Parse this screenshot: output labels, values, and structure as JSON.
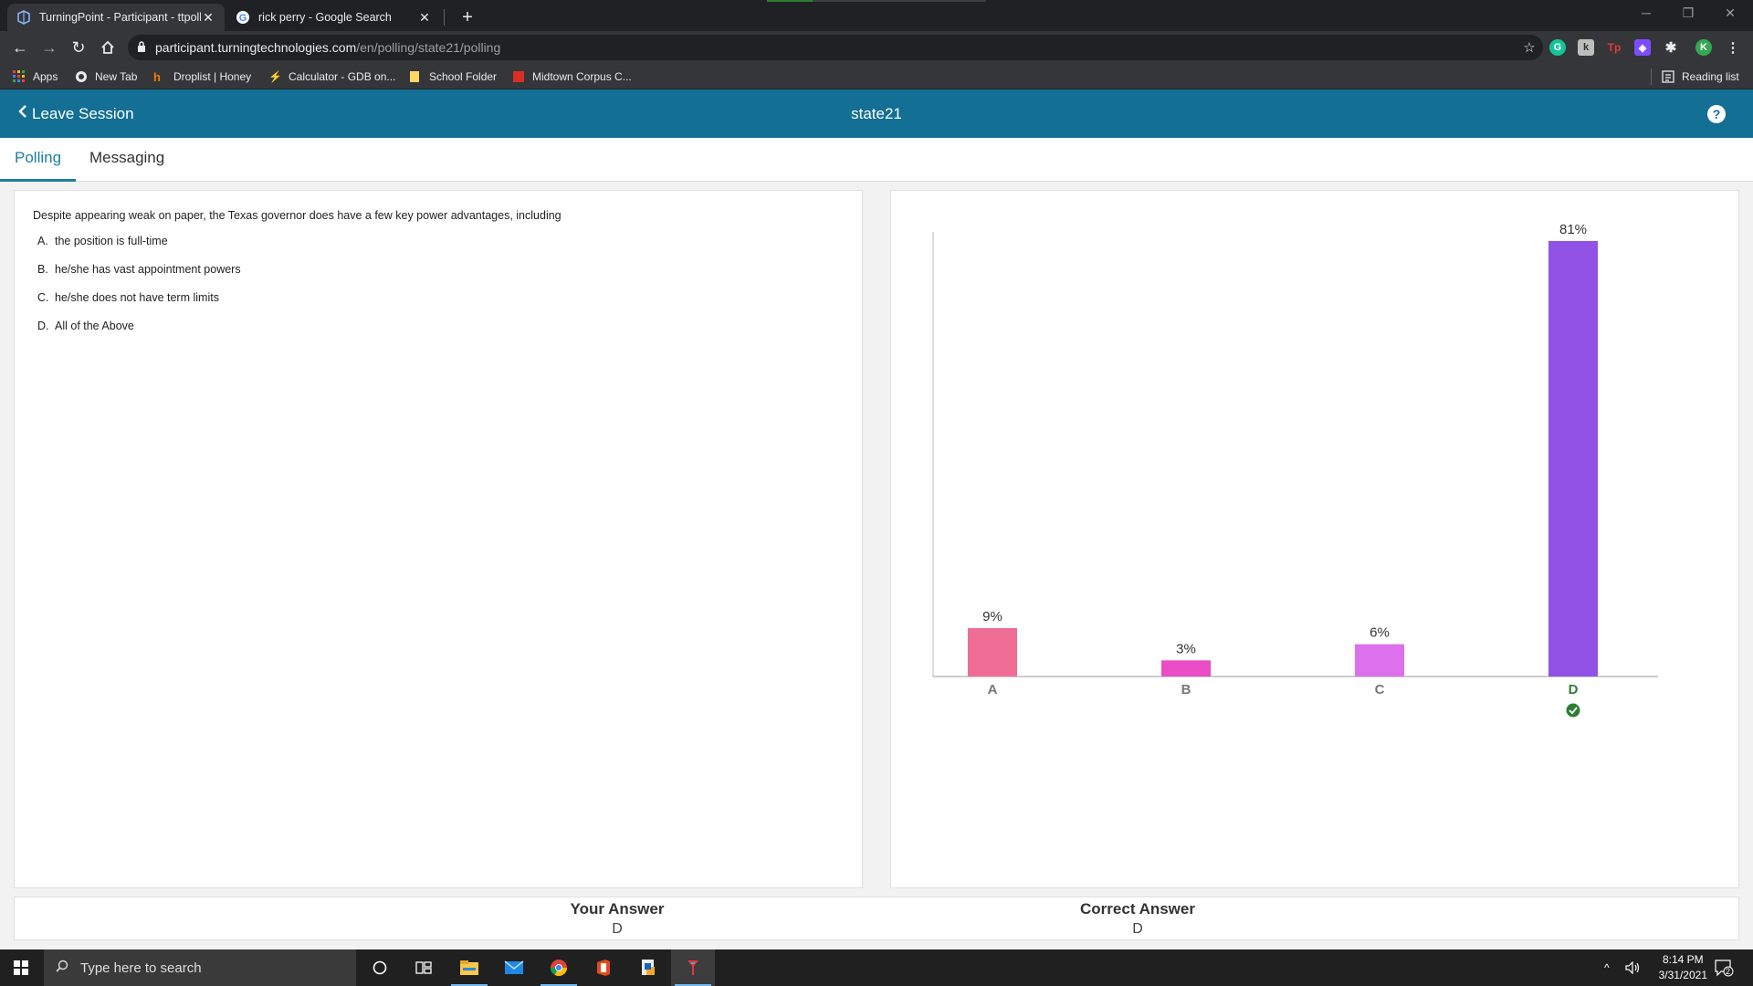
{
  "browser": {
    "tabs": [
      {
        "title": "TurningPoint - Participant - ttpoll",
        "close": "✕"
      },
      {
        "title": "rick perry - Google Search",
        "close": "✕"
      }
    ],
    "new_tab": "+",
    "url_host": "participant.turningtechnologies.com",
    "url_path": "/en/polling/state21/polling",
    "profile_initial": "K",
    "bookmarks": [
      {
        "label": "Apps"
      },
      {
        "label": "New Tab"
      },
      {
        "label": "Droplist | Honey"
      },
      {
        "label": "Calculator - GDB on..."
      },
      {
        "label": "School Folder"
      },
      {
        "label": "Midtown Corpus C..."
      }
    ],
    "reading_list": "Reading list"
  },
  "app": {
    "leave_label": "Leave Session",
    "session_name": "state21",
    "help_label": "?",
    "tabs": [
      {
        "label": "Polling",
        "active": true
      },
      {
        "label": "Messaging",
        "active": false
      }
    ],
    "accent_color": "#136f93"
  },
  "question": {
    "text": "Despite appearing weak on paper, the Texas governor does have a few key power advantages, including",
    "choices": [
      {
        "letter": "A.",
        "text": "the position is full-time"
      },
      {
        "letter": "B.",
        "text": "he/she has vast appointment powers"
      },
      {
        "letter": "C.",
        "text": "he/she does not have term limits"
      },
      {
        "letter": "D.",
        "text": "All of the Above"
      }
    ]
  },
  "chart_data": {
    "type": "bar",
    "categories": [
      "A",
      "B",
      "C",
      "D"
    ],
    "values": [
      9,
      3,
      6,
      81
    ],
    "value_labels": [
      "9%",
      "3%",
      "6%",
      "81%"
    ],
    "colors": [
      "#ee6e96",
      "#e94cc4",
      "#dd70ec",
      "#9152e6"
    ],
    "correct_category": "D",
    "ylim": [
      0,
      81
    ],
    "grid": false,
    "legend": "none"
  },
  "answers": {
    "your_answer_label": "Your Answer",
    "your_answer": "D",
    "correct_answer_label": "Correct Answer",
    "correct_answer": "D"
  },
  "taskbar": {
    "search_placeholder": "Type here to search",
    "time": "8:14 PM",
    "date": "3/31/2021",
    "notification_count": "2"
  }
}
